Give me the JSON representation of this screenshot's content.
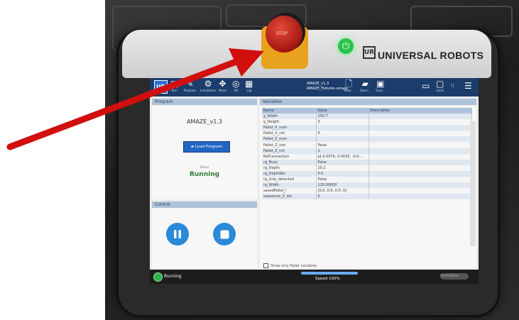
{
  "device": {
    "brand": "UNIVERSAL ROBOTS",
    "brand_logo": "UR",
    "estop_label": "STOP"
  },
  "topbar": {
    "logo": "UR",
    "items": [
      {
        "label": "Run",
        "icon": "run-icon"
      },
      {
        "label": "Program",
        "icon": "program-icon"
      },
      {
        "label": "Installation",
        "icon": "installation-icon"
      },
      {
        "label": "Move",
        "icon": "move-icon"
      },
      {
        "label": "I/O",
        "icon": "io-icon"
      },
      {
        "label": "Log",
        "icon": "log-icon"
      }
    ],
    "program_file": "AMAZE_v1.3",
    "installation_file": "AMAZE_Fixtures.urcaps",
    "file_actions": [
      {
        "label": "New...",
        "icon": "new-file-icon"
      },
      {
        "label": "Open...",
        "icon": "open-folder-icon"
      },
      {
        "label": "Save...",
        "icon": "save-icon"
      }
    ],
    "right_icons": [
      "urcaps-icon",
      "local-icon",
      "cc-icon",
      "menu-icon"
    ],
    "local_label": "Local"
  },
  "program_panel": {
    "title": "Program",
    "program_name": "AMAZE_v1.3",
    "load_button": "Load Program",
    "status_small": "Status",
    "status": "Running"
  },
  "control_panel": {
    "title": "Control",
    "play_pause": "pause",
    "stop": "stop"
  },
  "variables_panel": {
    "title": "Variables",
    "columns": [
      "Name",
      "Value",
      "Description"
    ],
    "rows": [
      [
        "g_Width",
        "150.7",
        ""
      ],
      [
        "g_Height",
        "3",
        ""
      ],
      [
        "Pallet_X_num",
        "",
        ""
      ],
      [
        "Pallet_X_cnt",
        "0",
        ""
      ],
      [
        "Pallet_Z_num",
        "",
        ""
      ],
      [
        "Pallet_Z_inst",
        "False",
        ""
      ],
      [
        "Pallet_Z_cnt",
        "1",
        ""
      ],
      [
        "RefConnection",
        "p[-0.0076, 0.0035, -0.0...",
        ""
      ],
      [
        "rg_Busy",
        "False",
        ""
      ],
      [
        "rg_Depth",
        "20.2",
        ""
      ],
      [
        "rg_DepthRel",
        "0.0",
        ""
      ],
      [
        "rg_Grip_detected",
        "False",
        ""
      ],
      [
        "rg_Width",
        "120.00000",
        ""
      ],
      [
        "savedPallet_i",
        "[0.0, 0.0, 0.0, 0]",
        ""
      ],
      [
        "sequence_Z_idx",
        "0",
        ""
      ]
    ],
    "checkbox_label": "Show only Pallet variables"
  },
  "bottombar": {
    "status": "Running",
    "speed": "Speed 100%",
    "speed_fraction": 1.0,
    "simulation_label": "Simulation"
  },
  "colors": {
    "topbar": "#1c3d6b",
    "accent": "#2b8ad8",
    "running": "#2e7d32",
    "arrow": "#d10f0f"
  }
}
